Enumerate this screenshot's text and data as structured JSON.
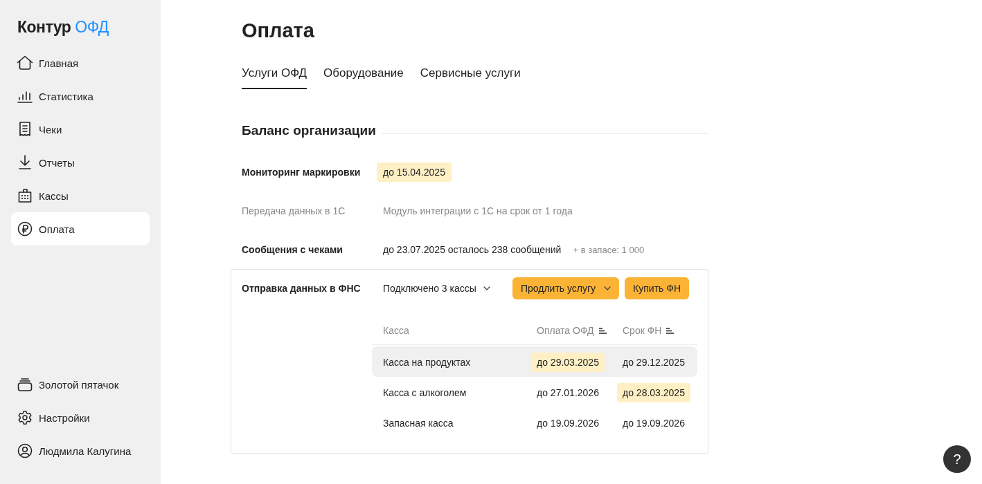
{
  "sidebar": {
    "logo": {
      "text": "Контур",
      "accent": "ОФД"
    },
    "items": [
      {
        "label": "Главная",
        "selected": false
      },
      {
        "label": "Статистика",
        "selected": false
      },
      {
        "label": "Чеки",
        "selected": false
      },
      {
        "label": "Отчеты",
        "selected": false
      },
      {
        "label": "Кассы",
        "selected": false
      },
      {
        "label": "Оплата",
        "selected": true
      }
    ],
    "bottom_items": [
      {
        "label": "Золотой пятачок"
      },
      {
        "label": "Настройки"
      },
      {
        "label": "Людмила Калугина"
      }
    ]
  },
  "page": {
    "title": "Оплата",
    "tabs": [
      {
        "label": "Услуги ОФД",
        "selected": true
      },
      {
        "label": "Оборудование",
        "selected": false
      },
      {
        "label": "Сервисные услуги",
        "selected": false
      }
    ]
  },
  "balance": {
    "heading": "Баланс организации",
    "services": [
      {
        "name": "Мониторинг маркировки",
        "disabled": false,
        "value": "до 15.04.2025",
        "highlighted": true
      },
      {
        "name": "Передача данных в 1С",
        "disabled": true,
        "value": "Модуль интеграции с 1С на срок от 1 года",
        "highlighted": false
      },
      {
        "name": "Сообщения с чеками",
        "disabled": false,
        "value": "до 23.07.2025 осталось 238 сообщений",
        "highlighted": false,
        "note": "+ в запасе: 1 000"
      }
    ],
    "fns": {
      "name": "Отправка данных в ФНС",
      "dropdown": "Подключено 3 кассы",
      "buttons": [
        {
          "label": "Продлить услугу",
          "caret": true
        },
        {
          "label": "Купить ФН",
          "caret": false
        }
      ],
      "table": {
        "columns": [
          {
            "label": "Касса",
            "sortable": false
          },
          {
            "label": "Оплата ОФД",
            "sortable": true
          },
          {
            "label": "Срок ФН",
            "sortable": true
          }
        ],
        "rows": [
          {
            "hovered": true,
            "cells": [
              {
                "text": "Касса на продуктах",
                "highlighted": false
              },
              {
                "text": "до 29.03.2025",
                "highlighted": true
              },
              {
                "text": "до 29.12.2025",
                "highlighted": false
              }
            ]
          },
          {
            "hovered": false,
            "cells": [
              {
                "text": "Касса с алкоголем",
                "highlighted": false
              },
              {
                "text": "до 27.01.2026",
                "highlighted": false
              },
              {
                "text": "до 28.03.2025",
                "highlighted": true
              }
            ]
          },
          {
            "hovered": false,
            "cells": [
              {
                "text": "Запасная касса",
                "highlighted": false
              },
              {
                "text": "до 19.09.2026",
                "highlighted": false
              },
              {
                "text": "до 19.09.2026",
                "highlighted": false
              }
            ]
          }
        ]
      }
    }
  },
  "help_button": "?"
}
